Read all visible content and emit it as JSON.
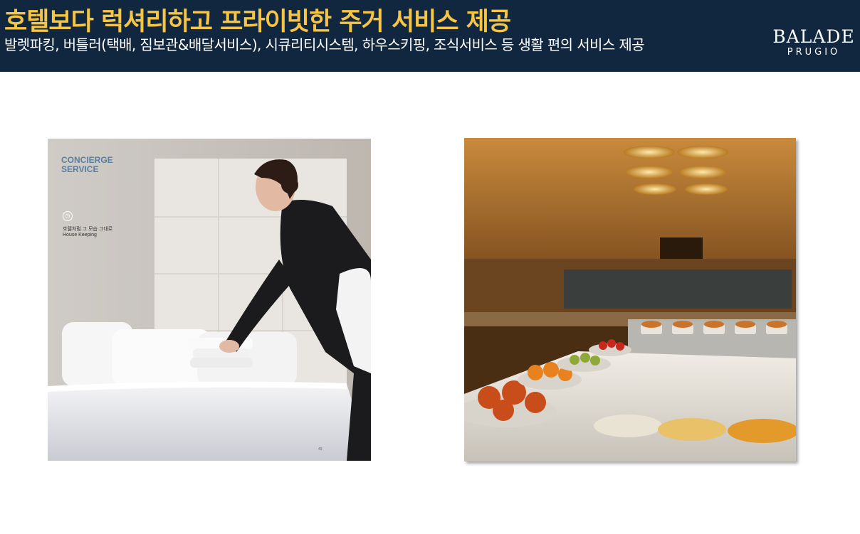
{
  "header": {
    "title": "호텔보다 럭셔리하고 프라이빗한 주거 서비스 제공",
    "subtitle": "발렛파킹, 버틀러(택배, 짐보관&배달서비스), 시큐리티시스템, 하우스키핑, 조식서비스 등 생활 편의 서비스 제공",
    "title_color": "#f5c543",
    "subtitle_color": "#ffffff",
    "background": "#11273f"
  },
  "logo": {
    "top": "BALADE",
    "bottom": "PRUGIO"
  },
  "photos": {
    "housekeeping": {
      "section_title": "CONCIERGE SERVICE",
      "text_ko": "호텔처럼 그 모습 그대로",
      "text_en": "House Keeping",
      "page_number": "49"
    },
    "buffet": {}
  }
}
